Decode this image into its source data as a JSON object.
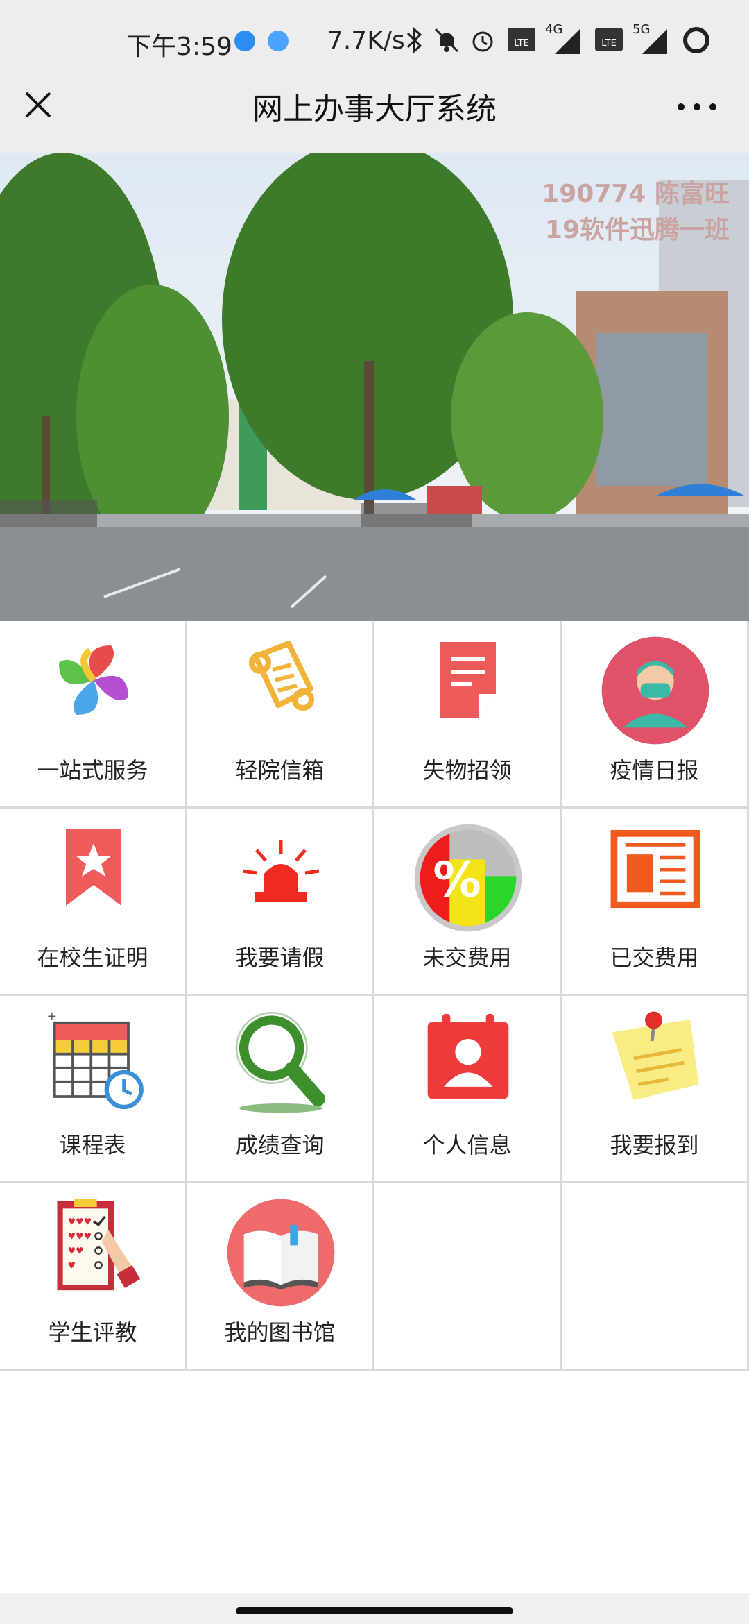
{
  "status_bar": {
    "time": "下午3:59",
    "network_speed": "7.7K/s",
    "signal_1": "4G",
    "signal_2": "5G"
  },
  "header": {
    "title": "网上办事大厅系统",
    "close_icon": "close-icon",
    "more_icon": "more-dots-icon"
  },
  "banner": {
    "line1": "190774 陈富旺",
    "line2": "19软件迅腾一班",
    "image": "campus-gate-photo"
  },
  "services": [
    {
      "label": "一站式服务",
      "icon": "pinwheel-icon"
    },
    {
      "label": "轻院信箱",
      "icon": "scroll-icon"
    },
    {
      "label": "失物招领",
      "icon": "document-icon"
    },
    {
      "label": "疫情日报",
      "icon": "doctor-mask-icon"
    },
    {
      "label": "在校生证明",
      "icon": "star-bookmark-icon"
    },
    {
      "label": "我要请假",
      "icon": "alarm-light-icon"
    },
    {
      "label": "未交费用",
      "icon": "percent-icon"
    },
    {
      "label": "已交费用",
      "icon": "newspaper-icon"
    },
    {
      "label": "课程表",
      "icon": "calendar-clock-icon"
    },
    {
      "label": "成绩查询",
      "icon": "magnifier-icon"
    },
    {
      "label": "个人信息",
      "icon": "contact-calendar-icon"
    },
    {
      "label": "我要报到",
      "icon": "sticky-note-icon"
    },
    {
      "label": "学生评教",
      "icon": "checklist-icon"
    },
    {
      "label": "我的图书馆",
      "icon": "book-icon"
    }
  ],
  "colors": {
    "header_bg": "#ededed",
    "grid_border": "#d9d9d9",
    "banner_text": "#c9a4a2"
  }
}
